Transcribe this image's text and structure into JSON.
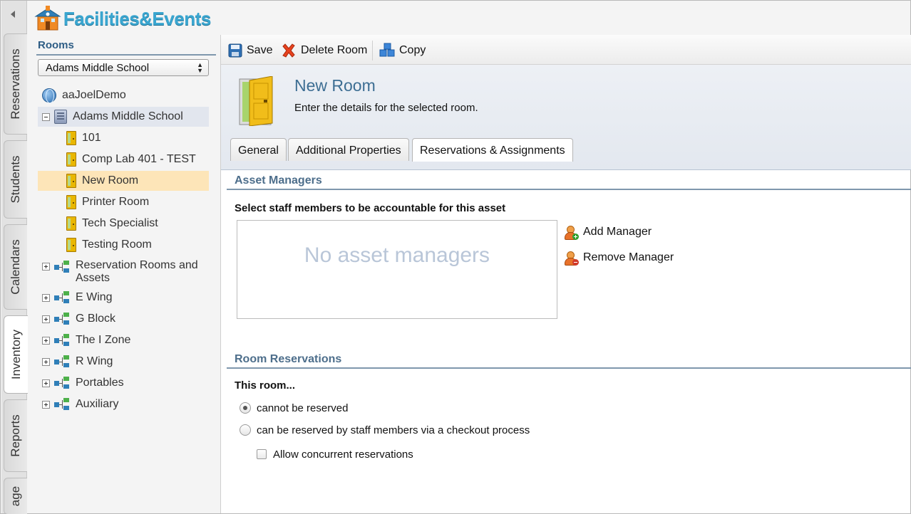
{
  "app": {
    "name": "Facilities&Events"
  },
  "side_tabs": [
    "Reservations",
    "Students",
    "Calendars",
    "Inventory",
    "Reports",
    "age"
  ],
  "tree": {
    "header": "Rooms",
    "school_select": "Adams Middle School",
    "items": [
      {
        "label": "aaJoelDemo"
      },
      {
        "label": "Adams Middle School"
      },
      {
        "label": "101"
      },
      {
        "label": "Comp Lab 401 - TEST"
      },
      {
        "label": "New Room"
      },
      {
        "label": "Printer Room"
      },
      {
        "label": "Tech Specialist"
      },
      {
        "label": "Testing Room"
      },
      {
        "label": "Reservation Rooms and Assets"
      },
      {
        "label": "E Wing"
      },
      {
        "label": "G Block"
      },
      {
        "label": "The I Zone"
      },
      {
        "label": "R Wing"
      },
      {
        "label": "Portables"
      },
      {
        "label": "Auxiliary"
      }
    ]
  },
  "toolbar": {
    "save": "Save",
    "delete": "Delete Room",
    "copy": "Copy"
  },
  "header": {
    "title": "New Room",
    "subtitle": "Enter the details for the selected room."
  },
  "tabs": [
    "General",
    "Additional Properties",
    "Reservations & Assignments"
  ],
  "asset_managers": {
    "title": "Asset Managers",
    "instruction": "Select staff members to be accountable for this asset",
    "empty_text": "No asset managers",
    "add": "Add Manager",
    "remove": "Remove Manager"
  },
  "reservations": {
    "title": "Room Reservations",
    "label": "This room...",
    "option_none": "cannot be reserved",
    "option_checkout": "can be reserved by staff members via a checkout process",
    "concurrent": "Allow concurrent reservations"
  }
}
